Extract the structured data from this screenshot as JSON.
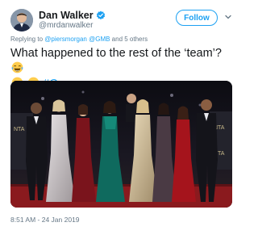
{
  "author": {
    "display_name": "Dan Walker",
    "handle": "@mrdanwalker",
    "verified": true
  },
  "follow_button": {
    "label": "Follow"
  },
  "reply_context": {
    "prefix": "Replying to",
    "mentions": [
      "@piersmorgan",
      "@GMB"
    ],
    "suffix": "and 5 others"
  },
  "tweet": {
    "text_main": "What happened to the rest of the ‘team’?",
    "hashtag": "#Crop",
    "emojis": [
      "face-with-tears-of-joy",
      "face-with-tears-of-joy",
      "face-with-tears-of-joy"
    ]
  },
  "media": {
    "type": "photo",
    "background_signage": [
      "NTA",
      "NTA",
      "NTA"
    ]
  },
  "timestamp": "8:51 AM - 24 Jan 2019",
  "colors": {
    "accent": "#1da1f2",
    "secondary_text": "#657786",
    "primary_text": "#14171a",
    "emoji_face": "#ffcc4d"
  }
}
